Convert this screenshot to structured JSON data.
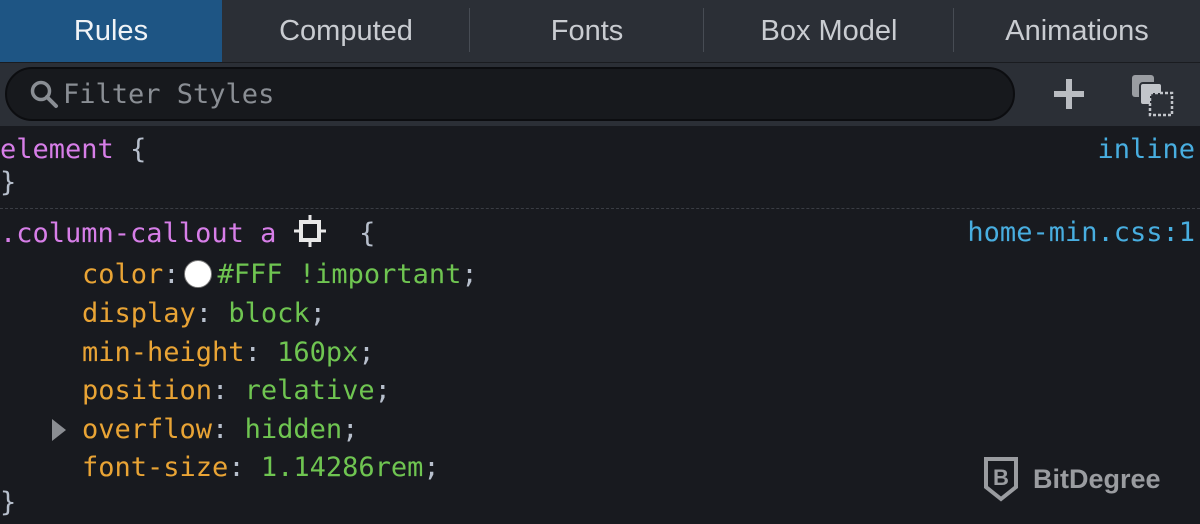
{
  "tabs": [
    {
      "label": "Rules",
      "active": true
    },
    {
      "label": "Computed",
      "active": false
    },
    {
      "label": "Fonts",
      "active": false
    },
    {
      "label": "Box Model",
      "active": false
    },
    {
      "label": "Animations",
      "active": false
    }
  ],
  "toolbar": {
    "filter_placeholder": "Filter Styles",
    "filter_value": "",
    "add_rule_icon": "plus-icon",
    "toggle_classes_icon": "copy-layers-icon"
  },
  "rules": [
    {
      "selector": "element",
      "open_brace": "{",
      "close_brace": "}",
      "source": "inline",
      "declarations": []
    },
    {
      "selector": ".column-callout a",
      "selector_icon": "node-highlight-icon",
      "open_brace": "{",
      "close_brace": "}",
      "source": "home-min.css:1",
      "declarations": [
        {
          "property": "color",
          "value": "#FFF !important",
          "swatch": "#FFFFFF"
        },
        {
          "property": "display",
          "value": "block"
        },
        {
          "property": "min-height",
          "value": "160px"
        },
        {
          "property": "position",
          "value": "relative"
        },
        {
          "property": "overflow",
          "value": "hidden",
          "expandable": true
        },
        {
          "property": "font-size",
          "value": "1.14286rem"
        }
      ]
    }
  ],
  "watermark": {
    "text": "BitDegree",
    "icon": "bitdegree-shield-icon"
  }
}
